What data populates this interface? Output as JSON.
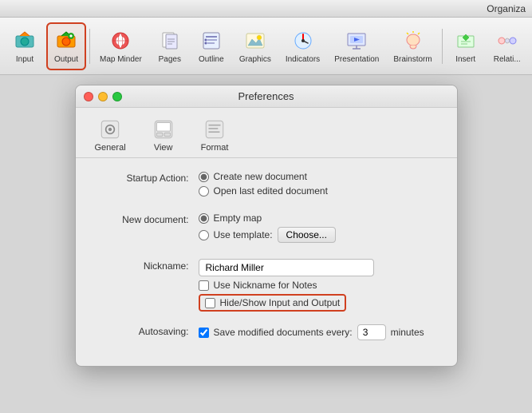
{
  "app": {
    "title": "Organiza"
  },
  "toolbar": {
    "items": [
      {
        "id": "input",
        "label": "Input",
        "selected": false
      },
      {
        "id": "output",
        "label": "Output",
        "selected": true
      },
      {
        "id": "map-minder",
        "label": "Map Minder",
        "selected": false
      },
      {
        "id": "pages",
        "label": "Pages",
        "selected": false
      },
      {
        "id": "outline",
        "label": "Outline",
        "selected": false
      },
      {
        "id": "graphics",
        "label": "Graphics",
        "selected": false
      },
      {
        "id": "indicators",
        "label": "Indicators",
        "selected": false
      },
      {
        "id": "presentation",
        "label": "Presentation",
        "selected": false
      },
      {
        "id": "brainstorm",
        "label": "Brainstorm",
        "selected": false
      },
      {
        "id": "insert",
        "label": "Insert",
        "selected": false
      },
      {
        "id": "relati",
        "label": "Relati...",
        "selected": false
      }
    ]
  },
  "dialog": {
    "title": "Preferences",
    "tabs": [
      {
        "id": "general",
        "label": "General"
      },
      {
        "id": "view",
        "label": "View"
      },
      {
        "id": "format",
        "label": "Format"
      }
    ],
    "startup": {
      "label": "Startup Action:",
      "option1": "Create new document",
      "option2": "Open last edited document",
      "selected": "create"
    },
    "new_document": {
      "label": "New document:",
      "option1": "Empty map",
      "option2": "Use template:",
      "selected": "empty",
      "choose_label": "Choose..."
    },
    "nickname": {
      "label": "Nickname:",
      "value": "Richard Miller",
      "use_nickname_label": "Use Nickname for Notes",
      "hide_show_label": "Hide/Show Input and Output"
    },
    "autosaving": {
      "label": "Autosaving:",
      "checkbox_label": "Save modified documents every:",
      "checked": true,
      "minutes_value": "3",
      "minutes_label": "minutes"
    }
  }
}
